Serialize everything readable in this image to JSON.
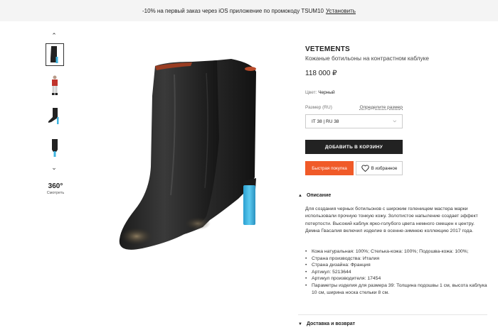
{
  "promo": {
    "text": "-10% на первый заказ через iOS приложение по промокоду TSUM10",
    "link": "Установить"
  },
  "gallery": {
    "up_icon": "chevron-up-icon",
    "down_icon": "chevron-down-icon",
    "thumbs": [
      "boot-front",
      "model-wearing",
      "boot-side",
      "boot-back"
    ],
    "active_thumb": 0,
    "rotate_label": "360°",
    "rotate_caption": "Смотреть"
  },
  "product": {
    "brand": "VETEMENTS",
    "title": "Кожаные ботильоны на контрастном каблуке",
    "price": "118 000 ₽",
    "color_label": "Цвет:",
    "color_value": "Черный",
    "size_label": "Размер (RU)",
    "size_guide": "Определите размер",
    "size_selected": "IT 38 | RU 38",
    "add_to_cart": "ДОБАВИТЬ В КОРЗИНУ",
    "quick_buy": "Быстрая покупка",
    "favorite": "В избранное"
  },
  "colors": {
    "accent": "#f05a28",
    "primary_button": "#222222",
    "promo_bg": "#f4f4f4",
    "heel": "#3fb4e0"
  },
  "description": {
    "heading": "Описание",
    "text": "Для создания черных ботильонов с широким голенищем мастера марки использовали прочную тонкую кожу. Золотистое напыление создает эффект потертости. Высокий каблук ярко-голубого цвета немного смещен к центру. Демна Гвасалия включил изделие в осенне-зимнюю коллекцию 2017 года.",
    "specs": [
      "Кожа натуральная: 100%; Стелька-кожа: 100%; Подошва-кожа: 100%;",
      "Страна производства: Италия",
      "Страна дизайна: Франция",
      "Артикул: 5213644",
      "Артикул производителя: 17454",
      "Параметры изделия для размера 39: Толщина подошвы 1 см, высота каблука 10 см, ширина носка стельки 8 см."
    ]
  },
  "delivery": {
    "heading": "Доставка и возврат"
  }
}
